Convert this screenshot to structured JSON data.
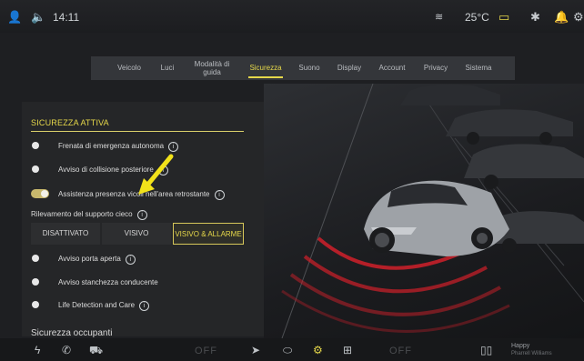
{
  "status": {
    "time": "14:11",
    "temperature": "25°C",
    "icons": [
      "profile-icon",
      "volume-icon",
      "wifi-icon",
      "battery-icon",
      "bluetooth-icon",
      "notification-icon",
      "settings-shortcut-icon"
    ]
  },
  "tabs": [
    {
      "label": "Veicolo"
    },
    {
      "label": "Luci"
    },
    {
      "label": "Modalità di guida"
    },
    {
      "label": "Sicurezza"
    },
    {
      "label": "Suono"
    },
    {
      "label": "Display"
    },
    {
      "label": "Account"
    },
    {
      "label": "Privacy"
    },
    {
      "label": "Sistema"
    }
  ],
  "section": {
    "title": "SICUREZZA ATTIVA",
    "rows": [
      {
        "label": "Frenata di emergenza autonoma"
      },
      {
        "label": "Avviso di collisione posteriore"
      },
      {
        "label": "Assistenza presenza vicoli nell'area retrostante"
      }
    ],
    "blind_spot_label": "Rilevamento del supporto cieco",
    "segments": [
      {
        "label": "DISATTIVATO"
      },
      {
        "label": "VISIVO"
      },
      {
        "label": "VISIVO & ALLARME"
      }
    ],
    "more_rows": [
      {
        "label": "Avviso porta aperta"
      },
      {
        "label": "Avviso stanchezza conducente"
      },
      {
        "label": "Life Detection and Care"
      }
    ]
  },
  "subsection_title": "Sicurezza occupanti",
  "bottombar": {
    "left_temp": "OFF",
    "right_temp": "OFF",
    "media_title": "Happy",
    "media_artist": "Pharrell Williams"
  },
  "colors": {
    "accent": "#e6d84a",
    "background": "#1e1f22",
    "panel": "#26272a",
    "scene_rear_lights": "#d0202a"
  }
}
